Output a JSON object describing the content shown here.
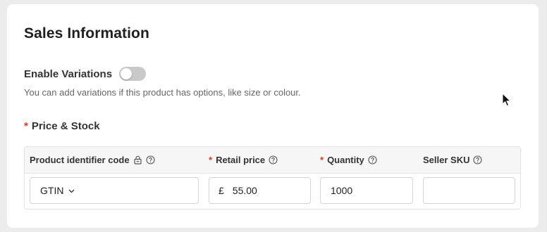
{
  "section": {
    "title": "Sales Information"
  },
  "variations": {
    "label": "Enable Variations",
    "enabled": false,
    "helper": "You can add variations if this product has options, like size or colour."
  },
  "price_stock": {
    "title": "Price & Stock",
    "required_mark": "*",
    "columns": [
      {
        "label": "Product identifier code",
        "required": false,
        "icons": [
          "lock-icon",
          "help-icon"
        ]
      },
      {
        "label": "Retail price",
        "required": true,
        "icons": [
          "help-icon"
        ]
      },
      {
        "label": "Quantity",
        "required": true,
        "icons": [
          "help-icon"
        ]
      },
      {
        "label": "Seller SKU",
        "required": false,
        "icons": [
          "help-icon"
        ]
      }
    ],
    "row": {
      "identifier_type": "GTIN",
      "currency_symbol": "£",
      "retail_price": "55.00",
      "quantity": "1000",
      "seller_sku": ""
    }
  },
  "colors": {
    "required": "#e0352b",
    "toggle_off": "#c9c9c9"
  }
}
